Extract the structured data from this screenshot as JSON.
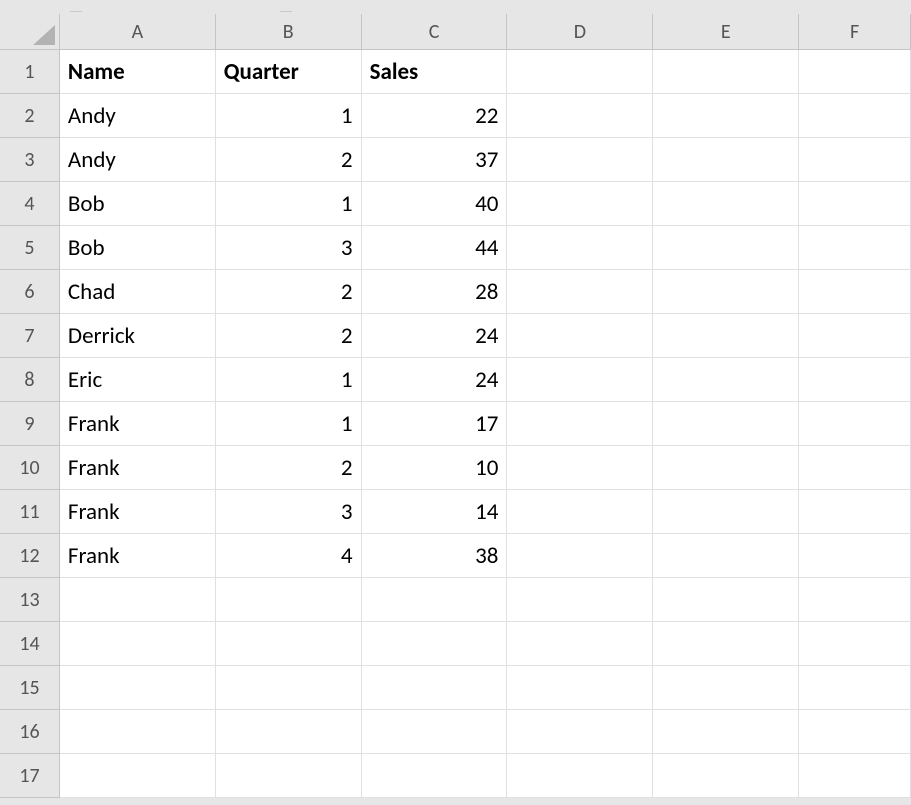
{
  "columns": [
    "A",
    "B",
    "C",
    "D",
    "E",
    "F"
  ],
  "row_numbers": [
    "1",
    "2",
    "3",
    "4",
    "5",
    "6",
    "7",
    "8",
    "9",
    "10",
    "11",
    "12",
    "13",
    "14",
    "15",
    "16",
    "17"
  ],
  "headers": {
    "A": "Name",
    "B": "Quarter",
    "C": "Sales"
  },
  "rows": [
    {
      "A": "Andy",
      "B": "1",
      "C": "22"
    },
    {
      "A": "Andy",
      "B": "2",
      "C": "37"
    },
    {
      "A": "Bob",
      "B": "1",
      "C": "40"
    },
    {
      "A": "Bob",
      "B": "3",
      "C": "44"
    },
    {
      "A": "Chad",
      "B": "2",
      "C": "28"
    },
    {
      "A": "Derrick",
      "B": "2",
      "C": "24"
    },
    {
      "A": "Eric",
      "B": "1",
      "C": "24"
    },
    {
      "A": "Frank",
      "B": "1",
      "C": "17"
    },
    {
      "A": "Frank",
      "B": "2",
      "C": "10"
    },
    {
      "A": "Frank",
      "B": "3",
      "C": "14"
    },
    {
      "A": "Frank",
      "B": "4",
      "C": "38"
    }
  ]
}
